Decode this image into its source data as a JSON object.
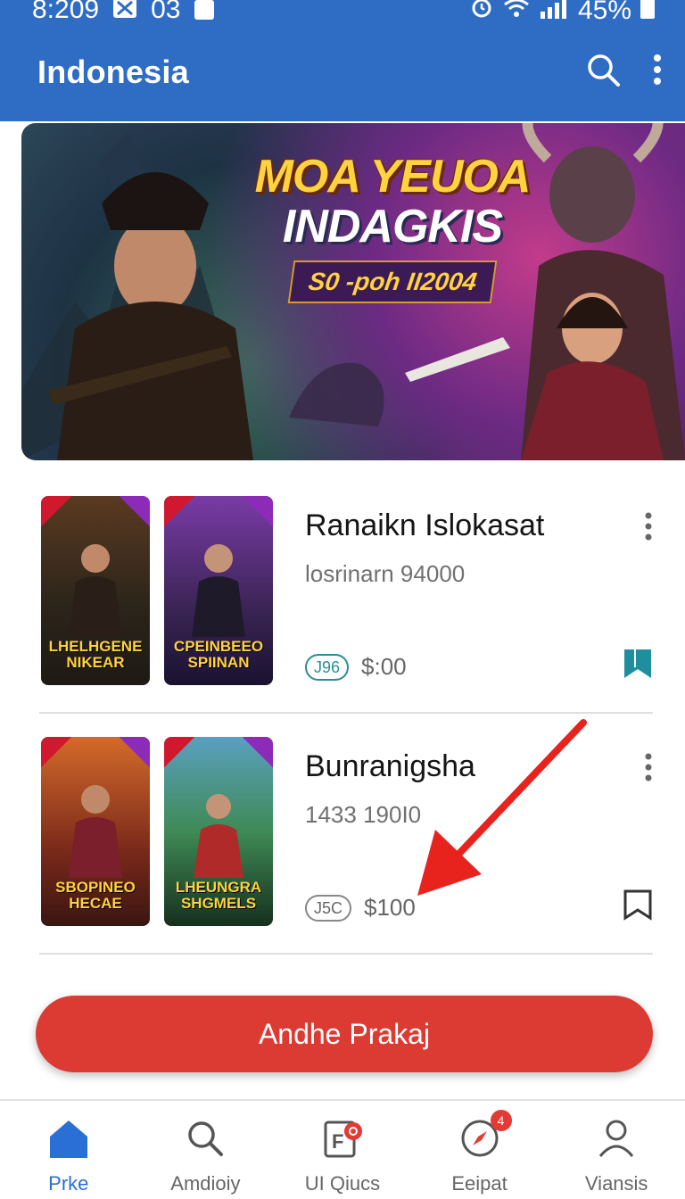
{
  "status_bar": {
    "time": "8:209",
    "notif_count": "03",
    "battery": "45%"
  },
  "app_bar": {
    "title": "Indonesia"
  },
  "banner": {
    "line1": "MOA YEUOA",
    "line2": "INDAGKIS",
    "subtitle": "S0 -poh II2004"
  },
  "cards": [
    {
      "title": "Ranaikn Islokasat",
      "subtitle": "losrinarn 94000",
      "tag": "J96",
      "price": "$:00",
      "bookmarked": true,
      "thumbs": [
        {
          "caption": "LHELHGENE NIKEAR",
          "colors": [
            "#5a3a22",
            "#1e1a14"
          ]
        },
        {
          "caption": "CPEINBEEO SPIINAN",
          "colors": [
            "#7a3ba6",
            "#1a1230"
          ]
        }
      ]
    },
    {
      "title": "Bunranigsha",
      "subtitle": "1433 190I0",
      "tag": "J5C",
      "price": "$100",
      "bookmarked": false,
      "thumbs": [
        {
          "caption": "SBOPINEO HECAE",
          "colors": [
            "#d46a2a",
            "#3a1510"
          ]
        },
        {
          "caption": "LHEUNGRA SHGMELS",
          "colors": [
            "#3f8a55",
            "#16301e"
          ]
        }
      ]
    }
  ],
  "cta": {
    "label": "Andhe Prakaj"
  },
  "bottom_nav": [
    {
      "label": "Prke",
      "icon": "home-icon",
      "active": true
    },
    {
      "label": "Amdioiy",
      "icon": "search-icon"
    },
    {
      "label": "UI Qiucs",
      "icon": "document-icon"
    },
    {
      "label": "Eeipat",
      "icon": "compass-icon",
      "badge": "4"
    },
    {
      "label": "Viansis",
      "icon": "person-icon"
    }
  ],
  "colors": {
    "primary": "#2f6cc4",
    "cta": "#dc3b34",
    "accent": "#2a8c96"
  }
}
